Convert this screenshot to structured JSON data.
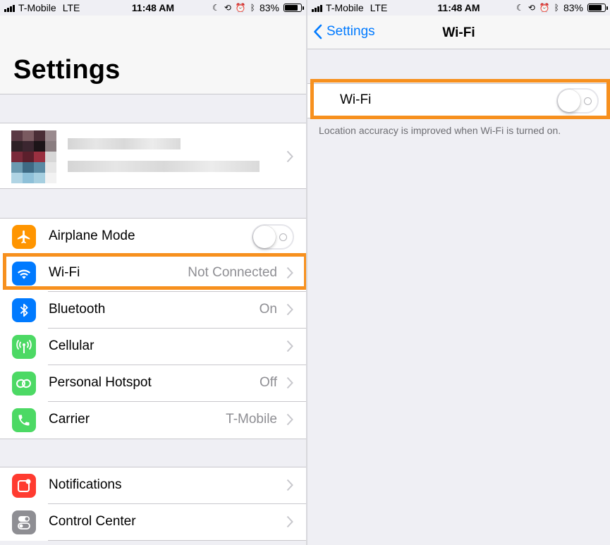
{
  "status_bar": {
    "carrier": "T-Mobile",
    "network": "LTE",
    "time": "11:48 AM",
    "battery": "83%",
    "battery_level": 0.83
  },
  "left": {
    "title": "Settings",
    "rows_group1": [
      {
        "name": "airplane-mode",
        "label": "Airplane Mode",
        "value": "",
        "icon": "airplane-icon",
        "color": "#ff9500",
        "toggle": "off"
      },
      {
        "name": "wifi",
        "label": "Wi-Fi",
        "value": "Not Connected",
        "icon": "wifi-icon",
        "color": "#007aff"
      },
      {
        "name": "bluetooth",
        "label": "Bluetooth",
        "value": "On",
        "icon": "bluetooth-icon",
        "color": "#007aff"
      },
      {
        "name": "cellular",
        "label": "Cellular",
        "value": "",
        "icon": "cellular-icon",
        "color": "#4cd964"
      },
      {
        "name": "personal-hotspot",
        "label": "Personal Hotspot",
        "value": "Off",
        "icon": "hotspot-icon",
        "color": "#4cd964"
      },
      {
        "name": "carrier",
        "label": "Carrier",
        "value": "T-Mobile",
        "icon": "phone-icon",
        "color": "#4cd964"
      }
    ],
    "rows_group2": [
      {
        "name": "notifications",
        "label": "Notifications",
        "value": "",
        "icon": "notifications-icon",
        "color": "#ff3b30"
      },
      {
        "name": "control-center",
        "label": "Control Center",
        "value": "",
        "icon": "control-center-icon",
        "color": "#8e8e93"
      }
    ]
  },
  "right": {
    "back_label": "Settings",
    "nav_title": "Wi-Fi",
    "wifi_label": "Wi-Fi",
    "wifi_toggle": "off",
    "footnote": "Location accuracy is improved when Wi-Fi is turned on."
  },
  "colors": {
    "highlight": "#f7901e",
    "ios_blue": "#007aff",
    "background": "#efeff4"
  }
}
